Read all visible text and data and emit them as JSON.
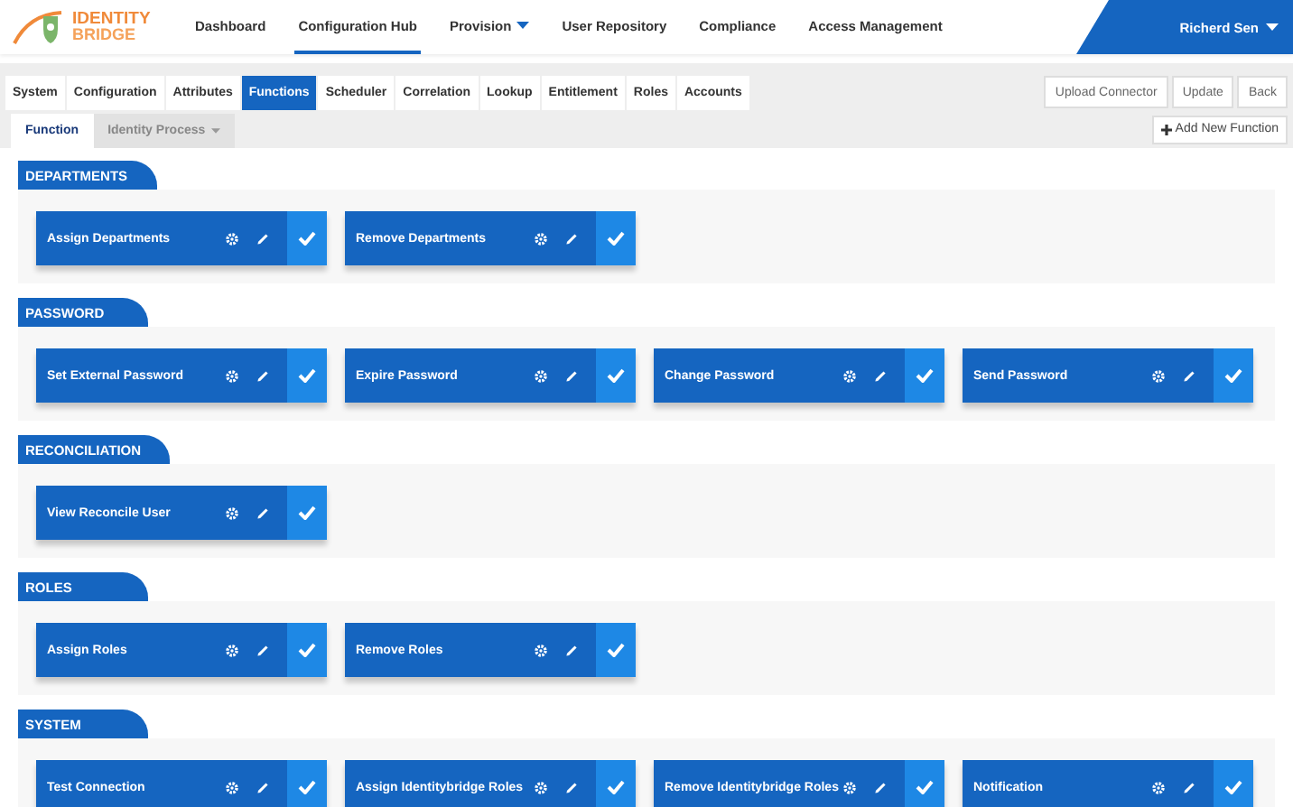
{
  "logo": {
    "line1": "IDENTITY",
    "line2": "BRIDGE"
  },
  "nav": [
    {
      "label": "Dashboard",
      "selected": false,
      "dropdown": false
    },
    {
      "label": "Configuration Hub",
      "selected": true,
      "dropdown": false
    },
    {
      "label": "Provision",
      "selected": false,
      "dropdown": true
    },
    {
      "label": "User Repository",
      "selected": false,
      "dropdown": false
    },
    {
      "label": "Compliance",
      "selected": false,
      "dropdown": false
    },
    {
      "label": "Access Management",
      "selected": false,
      "dropdown": false
    }
  ],
  "user": {
    "name": "Richerd Sen"
  },
  "tabs": [
    {
      "label": "System",
      "selected": false
    },
    {
      "label": "Configuration",
      "selected": false
    },
    {
      "label": "Attributes",
      "selected": false
    },
    {
      "label": "Functions",
      "selected": true
    },
    {
      "label": "Scheduler",
      "selected": false
    },
    {
      "label": "Correlation",
      "selected": false
    },
    {
      "label": "Lookup",
      "selected": false
    },
    {
      "label": "Entitlement",
      "selected": false
    },
    {
      "label": "Roles",
      "selected": false
    },
    {
      "label": "Accounts",
      "selected": false
    }
  ],
  "actions": [
    "Upload Connector",
    "Update",
    "Back"
  ],
  "subtabs": [
    {
      "label": "Function",
      "selected": true,
      "dropdown": false
    },
    {
      "label": "Identity Process",
      "selected": false,
      "dropdown": true
    }
  ],
  "add_button": "Add New Function",
  "sections": [
    {
      "title": "DEPARTMENTS",
      "functions": [
        "Assign Departments",
        "Remove Departments"
      ]
    },
    {
      "title": "PASSWORD",
      "functions": [
        "Set External Password",
        "Expire Password",
        "Change Password",
        "Send Password"
      ]
    },
    {
      "title": "RECONCILIATION",
      "functions": [
        "View Reconcile User"
      ]
    },
    {
      "title": "ROLES",
      "functions": [
        "Assign Roles",
        "Remove Roles"
      ]
    },
    {
      "title": "SYSTEM",
      "functions": [
        "Test Connection",
        "Assign Identitybridge Roles",
        "Remove Identitybridge Roles",
        "Notification"
      ]
    }
  ]
}
